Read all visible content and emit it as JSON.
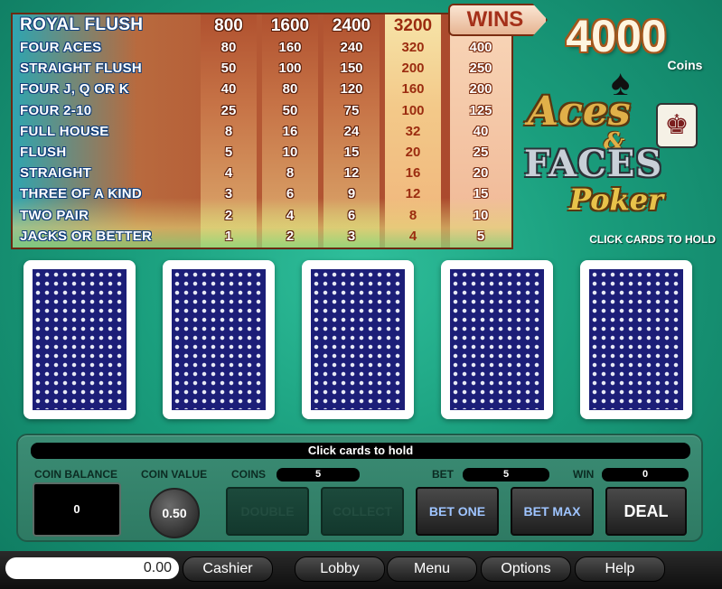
{
  "paytable": {
    "columns": [
      "800",
      "1600",
      "2400",
      "3200"
    ],
    "rows": [
      {
        "hand": "ROYAL FLUSH",
        "pays": [
          "800",
          "1600",
          "2400",
          "3200"
        ],
        "win": ""
      },
      {
        "hand": "FOUR ACES",
        "pays": [
          "80",
          "160",
          "240",
          "320"
        ],
        "win": "400"
      },
      {
        "hand": "STRAIGHT FLUSH",
        "pays": [
          "50",
          "100",
          "150",
          "200"
        ],
        "win": "250"
      },
      {
        "hand": "FOUR J, Q OR K",
        "pays": [
          "40",
          "80",
          "120",
          "160"
        ],
        "win": "200"
      },
      {
        "hand": "FOUR 2-10",
        "pays": [
          "25",
          "50",
          "75",
          "100"
        ],
        "win": "125"
      },
      {
        "hand": "FULL HOUSE",
        "pays": [
          "8",
          "16",
          "24",
          "32"
        ],
        "win": "40"
      },
      {
        "hand": "FLUSH",
        "pays": [
          "5",
          "10",
          "15",
          "20"
        ],
        "win": "25"
      },
      {
        "hand": "STRAIGHT",
        "pays": [
          "4",
          "8",
          "12",
          "16"
        ],
        "win": "20"
      },
      {
        "hand": "THREE OF A KIND",
        "pays": [
          "3",
          "6",
          "9",
          "12"
        ],
        "win": "15"
      },
      {
        "hand": "TWO PAIR",
        "pays": [
          "2",
          "4",
          "6",
          "8"
        ],
        "win": "10"
      },
      {
        "hand": "JACKS OR BETTER",
        "pays": [
          "1",
          "2",
          "3",
          "4"
        ],
        "win": "5"
      }
    ]
  },
  "wins": {
    "label": "WINS",
    "amount": "4000",
    "unit": "Coins"
  },
  "logo": {
    "line1": "Aces",
    "amp": "&",
    "line2": "FACES",
    "line3": "Poker",
    "spade_icon": "spade-icon",
    "king_icon": "king-card-icon"
  },
  "hold_hint": "CLICK CARDS TO HOLD",
  "cards": [
    {
      "state": "face-down"
    },
    {
      "state": "face-down"
    },
    {
      "state": "face-down"
    },
    {
      "state": "face-down"
    },
    {
      "state": "face-down"
    }
  ],
  "panel": {
    "message": "Click cards to hold",
    "coin_balance_label": "COIN BALANCE",
    "coin_balance": "0",
    "coin_value_label": "COIN VALUE",
    "coin_value": "0.50",
    "coins_label": "COINS",
    "coins": "5",
    "bet_label": "BET",
    "bet": "5",
    "win_label": "WIN",
    "win": "0",
    "double_label": "DOUBLE",
    "collect_label": "COLLECT",
    "bet_one_label": "BET ONE",
    "bet_max_label": "BET MAX",
    "deal_label": "DEAL"
  },
  "bottom_bar": {
    "balance": "0.00",
    "cashier": "Cashier",
    "lobby": "Lobby",
    "menu": "Menu",
    "options": "Options",
    "help": "Help"
  },
  "colors": {
    "felt": "#1a9e7d",
    "card_back": "#1c1e78",
    "hand_name_outline": "#123f7a",
    "selected_column": "#f3c989"
  }
}
